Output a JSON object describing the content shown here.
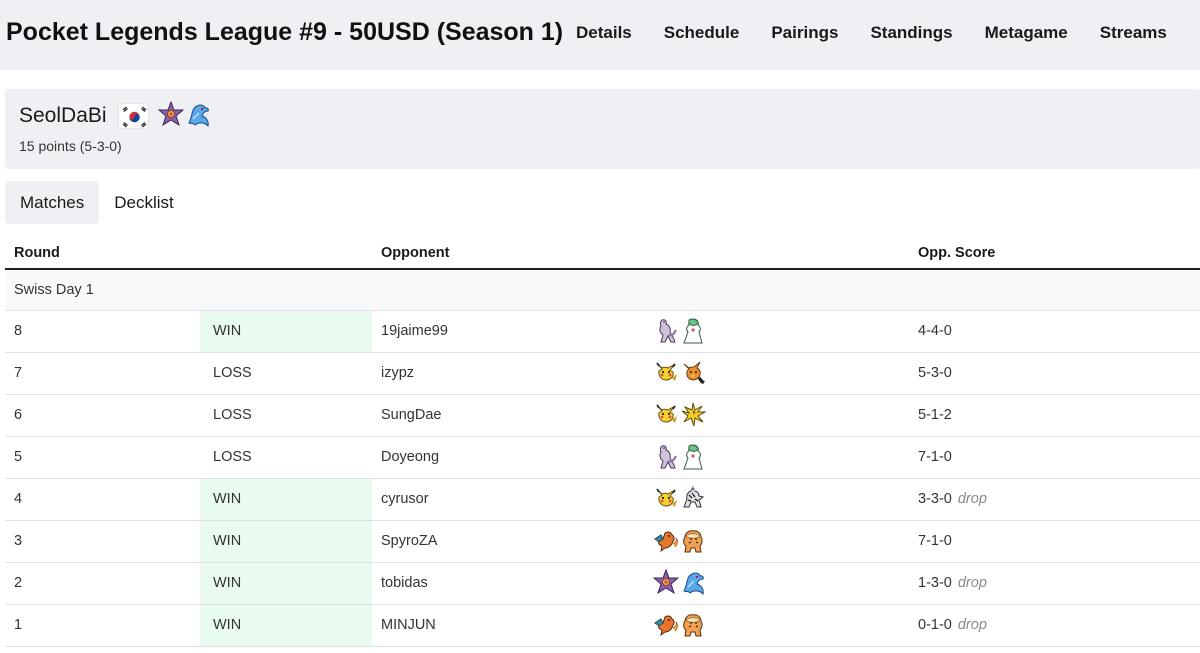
{
  "header": {
    "title": "Pocket Legends League #9 - 50USD (Season 1)",
    "nav": [
      "Details",
      "Schedule",
      "Pairings",
      "Standings",
      "Metagame",
      "Streams"
    ]
  },
  "player": {
    "name": "SeolDaBi",
    "flag_icon": "south-korea-flag-icon",
    "points": "15 points (5-3-0)",
    "deck_icons": [
      "starmie-icon",
      "articuno-icon"
    ]
  },
  "tabs": {
    "matches": "Matches",
    "decklist": "Decklist",
    "active": "matches"
  },
  "table": {
    "headers": {
      "round": "Round",
      "opponent": "Opponent",
      "opp_score": "Opp. Score"
    },
    "section": "Swiss Day 1",
    "colors": {
      "win_bg": "#e8fbee",
      "section_bg": "#f8f9fa"
    },
    "rows": [
      {
        "round": "8",
        "result": "WIN",
        "opponent": "19jaime99",
        "deck": [
          "mewtwo-icon",
          "gardevoir-icon"
        ],
        "score": "4-4-0",
        "drop": ""
      },
      {
        "round": "7",
        "result": "LOSS",
        "opponent": "izypz",
        "deck": [
          "pikachu-icon",
          "raichu-icon"
        ],
        "score": "5-3-0",
        "drop": ""
      },
      {
        "round": "6",
        "result": "LOSS",
        "opponent": "SungDae",
        "deck": [
          "pikachu-icon",
          "zapdos-icon"
        ],
        "score": "5-1-2",
        "drop": ""
      },
      {
        "round": "5",
        "result": "LOSS",
        "opponent": "Doyeong",
        "deck": [
          "mewtwo-icon",
          "gardevoir-icon"
        ],
        "score": "7-1-0",
        "drop": ""
      },
      {
        "round": "4",
        "result": "WIN",
        "opponent": "cyrusor",
        "deck": [
          "pikachu-icon",
          "zebstrika-icon"
        ],
        "score": "3-3-0",
        "drop": "drop"
      },
      {
        "round": "3",
        "result": "WIN",
        "opponent": "SpyroZA",
        "deck": [
          "charizard-icon",
          "arcanine-icon"
        ],
        "score": "7-1-0",
        "drop": ""
      },
      {
        "round": "2",
        "result": "WIN",
        "opponent": "tobidas",
        "deck": [
          "starmie-icon",
          "articuno-icon"
        ],
        "score": "1-3-0",
        "drop": "drop"
      },
      {
        "round": "1",
        "result": "WIN",
        "opponent": "MINJUN",
        "deck": [
          "charizard-icon",
          "arcanine-icon"
        ],
        "score": "0-1-0",
        "drop": "drop"
      }
    ]
  }
}
